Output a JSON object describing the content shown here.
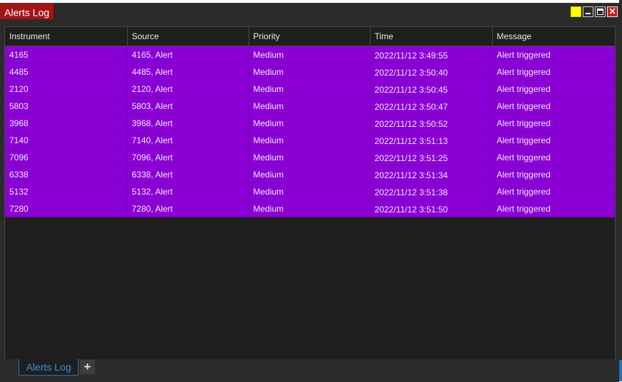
{
  "window": {
    "title": "Alerts Log",
    "controls": {
      "color_swatch": "#ffff00",
      "minimize": "minimize-icon",
      "maximize": "maximize-icon",
      "close": "close-icon",
      "close_glyph": "✕"
    }
  },
  "table": {
    "columns": [
      "Instrument",
      "Source",
      "Priority",
      "Time",
      "Message"
    ],
    "row_color": "#8a00d4",
    "rows": [
      {
        "instrument": "4165",
        "source": "4165, Alert",
        "priority": "Medium",
        "time": "2022/11/12 3:49:55",
        "message": "Alert triggered"
      },
      {
        "instrument": "4485",
        "source": "4485, Alert",
        "priority": "Medium",
        "time": "2022/11/12 3:50:40",
        "message": "Alert triggered"
      },
      {
        "instrument": "2120",
        "source": "2120, Alert",
        "priority": "Medium",
        "time": "2022/11/12 3:50:45",
        "message": "Alert triggered"
      },
      {
        "instrument": "5803",
        "source": "5803, Alert",
        "priority": "Medium",
        "time": "2022/11/12 3:50:47",
        "message": "Alert triggered"
      },
      {
        "instrument": "3968",
        "source": "3968, Alert",
        "priority": "Medium",
        "time": "2022/11/12 3:50:52",
        "message": "Alert triggered"
      },
      {
        "instrument": "7140",
        "source": "7140, Alert",
        "priority": "Medium",
        "time": "2022/11/12 3:51:13",
        "message": "Alert triggered"
      },
      {
        "instrument": "7096",
        "source": "7096, Alert",
        "priority": "Medium",
        "time": "2022/11/12 3:51:25",
        "message": "Alert triggered"
      },
      {
        "instrument": "6338",
        "source": "6338, Alert",
        "priority": "Medium",
        "time": "2022/11/12 3:51:34",
        "message": "Alert triggered"
      },
      {
        "instrument": "5132",
        "source": "5132, Alert",
        "priority": "Medium",
        "time": "2022/11/12 3:51:38",
        "message": "Alert triggered"
      },
      {
        "instrument": "7280",
        "source": "7280, Alert",
        "priority": "Medium",
        "time": "2022/11/12 3:51:50",
        "message": "Alert triggered"
      }
    ]
  },
  "bottom_tabs": {
    "active_label": "Alerts Log",
    "add_label": "+"
  }
}
